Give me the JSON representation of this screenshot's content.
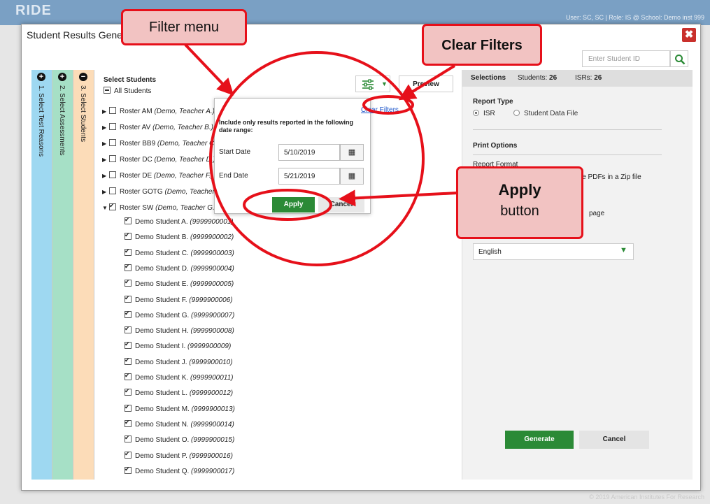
{
  "background": {
    "logo": "RIDE",
    "user_info": "User: SC, SC | Role: IS @ School: Demo inst 999",
    "copyright": "© 2019 American Institutes For Research"
  },
  "modal": {
    "title": "Student Results Generator",
    "close_label": "✖",
    "student_id_placeholder": "Enter Student ID"
  },
  "steps": [
    {
      "label": "1. Select Test Reasons",
      "icon": "plus-circle-icon",
      "icon_glyph": "+",
      "color": "#9ed8f1"
    },
    {
      "label": "2. Select Assessments",
      "icon": "plus-circle-icon",
      "icon_glyph": "+",
      "color": "#a6e0c6"
    },
    {
      "label": "3. Select Students",
      "icon": "minus-circle-icon",
      "icon_glyph": "−",
      "color": "#fcdcb8"
    }
  ],
  "students_panel": {
    "title": "Select Students",
    "all_label": "All Students",
    "preview_label": "Preview",
    "rosters": [
      {
        "name": "Roster AM",
        "teacher": "(Demo, Teacher A.)",
        "expanded": false,
        "checked": false
      },
      {
        "name": "Roster AV",
        "teacher": "(Demo, Teacher B.)",
        "expanded": false,
        "checked": false
      },
      {
        "name": "Roster BB9",
        "teacher": "(Demo, Teacher C.)",
        "expanded": false,
        "checked": false
      },
      {
        "name": "Roster DC",
        "teacher": "(Demo, Teacher D.)",
        "expanded": false,
        "checked": false
      },
      {
        "name": "Roster DE",
        "teacher": "(Demo, Teacher F.)",
        "expanded": false,
        "checked": false
      },
      {
        "name": "Roster GOTG",
        "teacher": "(Demo, Teacher F.)",
        "expanded": false,
        "checked": false
      },
      {
        "name": "Roster SW",
        "teacher": "(Demo, Teacher G.)",
        "expanded": true,
        "checked": true
      }
    ],
    "students": [
      {
        "name": "Demo Student A.",
        "id": "(9999900001)"
      },
      {
        "name": "Demo Student B.",
        "id": "(9999900002)"
      },
      {
        "name": "Demo Student C.",
        "id": "(9999900003)"
      },
      {
        "name": "Demo Student D.",
        "id": "(9999900004)"
      },
      {
        "name": "Demo Student E.",
        "id": "(9999900005)"
      },
      {
        "name": "Demo Student F.",
        "id": "(9999900006)"
      },
      {
        "name": "Demo Student G.",
        "id": "(9999900007)"
      },
      {
        "name": "Demo Student H.",
        "id": "(9999900008)"
      },
      {
        "name": "Demo Student I.",
        "id": "(9999900009)"
      },
      {
        "name": "Demo Student J.",
        "id": "(9999900010)"
      },
      {
        "name": "Demo Student K.",
        "id": "(9999900011)"
      },
      {
        "name": "Demo Student L.",
        "id": "(9999900012)"
      },
      {
        "name": "Demo Student M.",
        "id": "(9999900013)"
      },
      {
        "name": "Demo Student N.",
        "id": "(9999900014)"
      },
      {
        "name": "Demo Student O.",
        "id": "(9999900015)"
      },
      {
        "name": "Demo Student P.",
        "id": "(9999900016)"
      },
      {
        "name": "Demo Student Q.",
        "id": "(9999900017)"
      }
    ]
  },
  "filter_popup": {
    "clear_label": "Clear Filters",
    "description": "Include only results reported in the following date range:",
    "start_label": "Start Date",
    "start_value": "5/10/2019",
    "end_label": "End Date",
    "end_value": "5/21/2019",
    "apply_label": "Apply",
    "cancel_label": "Cancel"
  },
  "right_panel": {
    "selections_label": "Selections",
    "students_label": "Students:",
    "students_count": "26",
    "isrs_label": "ISRs:",
    "isrs_count": "26",
    "report_type_label": "Report Type",
    "isr_option": "ISR",
    "sdf_option": "Student Data File",
    "print_options_label": "Print Options",
    "report_format_label": "Report Format",
    "format_option_fragment": "le PDFs in a Zip file",
    "page_option_fragment": "page",
    "language_value": "English",
    "generate_label": "Generate",
    "cancel_label": "Cancel"
  },
  "annotations": {
    "filter_menu": "Filter menu",
    "clear_filters": "Clear Filters",
    "apply_line1": "Apply",
    "apply_line2": "button",
    "accent_color": "#e6101a"
  },
  "colors": {
    "green": "#2b8a36",
    "link": "#1a53c9"
  }
}
